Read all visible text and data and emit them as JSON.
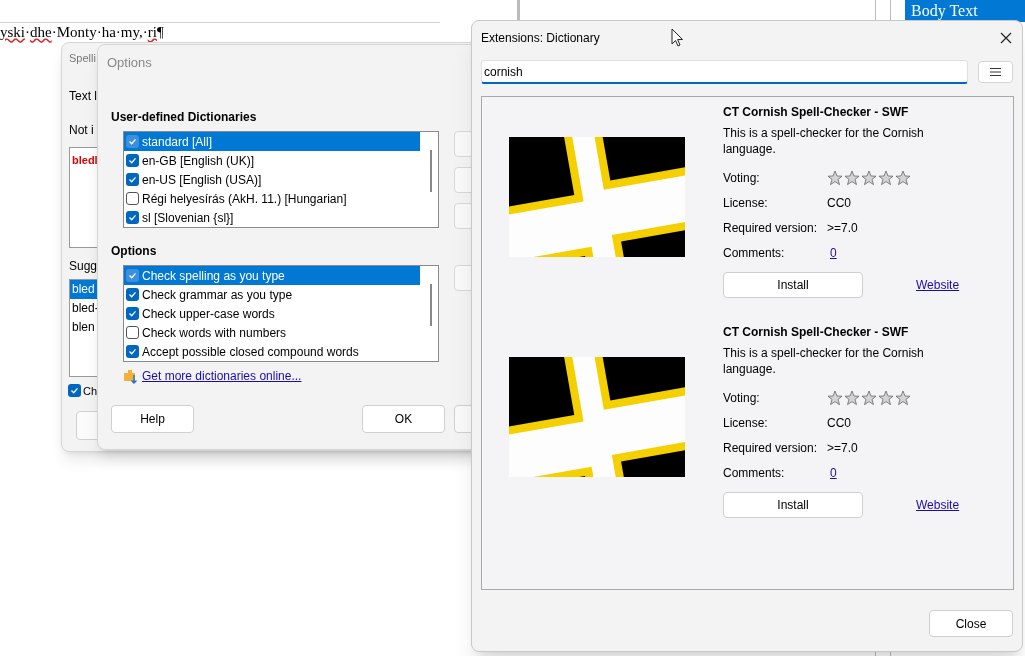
{
  "document": {
    "segments": [
      {
        "text": "yski",
        "misspelled": true
      },
      {
        "text": "·",
        "misspelled": false
      },
      {
        "text": "dhe",
        "misspelled": true
      },
      {
        "text": "·Monty·ha·my,·",
        "misspelled": false
      },
      {
        "text": "ri",
        "misspelled": true
      },
      {
        "text": "¶",
        "misspelled": false
      }
    ]
  },
  "style_box": {
    "text": "Body Text"
  },
  "spelling_dialog": {
    "title": "Spelli",
    "text_label": "Text l",
    "not_label": "Not i",
    "not_in_dictionary": "bledl",
    "suggestions_label": "Sugg",
    "suggestions": [
      {
        "text": "bled",
        "selected": true
      },
      {
        "text": "bled-",
        "selected": false
      },
      {
        "text": "blen",
        "selected": false
      }
    ],
    "checkbox": {
      "label": "Ch",
      "checked": true
    }
  },
  "options_dialog": {
    "title": "Options",
    "dictionaries_heading": "User-defined Dictionaries",
    "dictionaries": [
      {
        "label": "standard [All]",
        "checked": true,
        "selected": true
      },
      {
        "label": "en-GB [English (UK)]",
        "checked": true,
        "selected": false
      },
      {
        "label": "en-US [English (USA)]",
        "checked": true,
        "selected": false
      },
      {
        "label": "Régi helyesírás (AkH. 11.) [Hungarian]",
        "checked": false,
        "selected": false
      },
      {
        "label": "sl [Slovenian {sl}]",
        "checked": true,
        "selected": false
      }
    ],
    "options_heading": "Options",
    "options": [
      {
        "label": "Check spelling as you type",
        "checked": true,
        "selected": true
      },
      {
        "label": "Check grammar as you type",
        "checked": true,
        "selected": false
      },
      {
        "label": "Check upper-case words",
        "checked": true,
        "selected": false
      },
      {
        "label": "Check words with numbers",
        "checked": false,
        "selected": false
      },
      {
        "label": "Accept possible closed compound words",
        "checked": true,
        "selected": false
      }
    ],
    "link": "Get more dictionaries online...",
    "help": "Help",
    "ok": "OK"
  },
  "extensions": {
    "title": "Extensions: Dictionary",
    "search": {
      "value": "cornish"
    },
    "items": [
      {
        "title": "CT Cornish Spell-Checker - SWF",
        "description": "This is a spell-checker for the Cornish language.",
        "voting_label": "Voting:",
        "stars": 0,
        "license_label": "License:",
        "license": "CC0",
        "version_label": "Required version:",
        "version": ">=7.0",
        "comments_label": "Comments:",
        "comments": "0",
        "install": "Install",
        "website": "Website"
      },
      {
        "title": "CT Cornish Spell-Checker - SWF",
        "description": "This is a spell-checker for the Cornish language.",
        "voting_label": "Voting:",
        "stars": 0,
        "license_label": "License:",
        "license": "CC0",
        "version_label": "Required version:",
        "version": ">=7.0",
        "comments_label": "Comments:",
        "comments": "0",
        "install": "Install",
        "website": "Website"
      }
    ],
    "close": "Close"
  }
}
